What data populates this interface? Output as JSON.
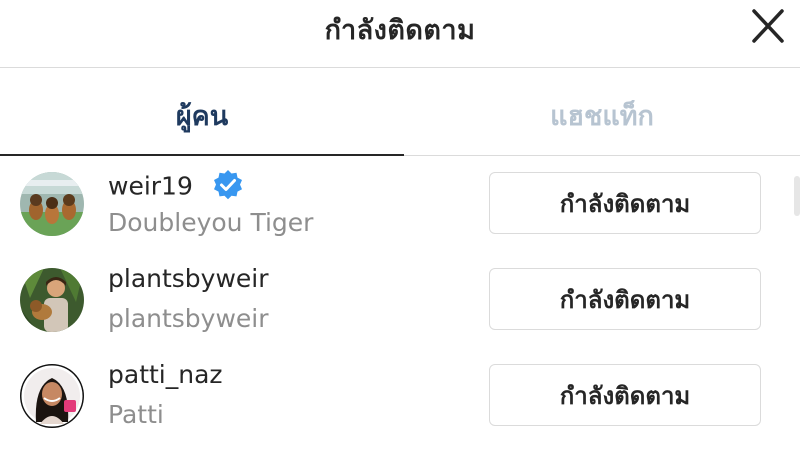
{
  "header": {
    "title": "กำลังติดตาม",
    "close_icon": "close-icon"
  },
  "tabs": [
    {
      "label": "ผู้คน",
      "active": true
    },
    {
      "label": "แฮชแท็ก",
      "active": false
    }
  ],
  "colors": {
    "active_tab": "#1f3a5f",
    "inactive_tab": "#b7c4d1",
    "verified": "#3897f0",
    "secondary_text": "#8e8e8e",
    "border": "#dbdbdb"
  },
  "following": [
    {
      "username": "weir19",
      "verified": true,
      "full_name": "Doubleyou Tiger",
      "button_label": "กำลังติดตาม",
      "avatar_icon": "avatar-dogs"
    },
    {
      "username": "plantsbyweir",
      "verified": false,
      "full_name": "plantsbyweir",
      "button_label": "กำลังติดตาม",
      "avatar_icon": "avatar-person-with-dog"
    },
    {
      "username": "patti_naz",
      "verified": false,
      "full_name": "Patti",
      "button_label": "กำลังติดตาม",
      "avatar_icon": "avatar-woman"
    }
  ]
}
